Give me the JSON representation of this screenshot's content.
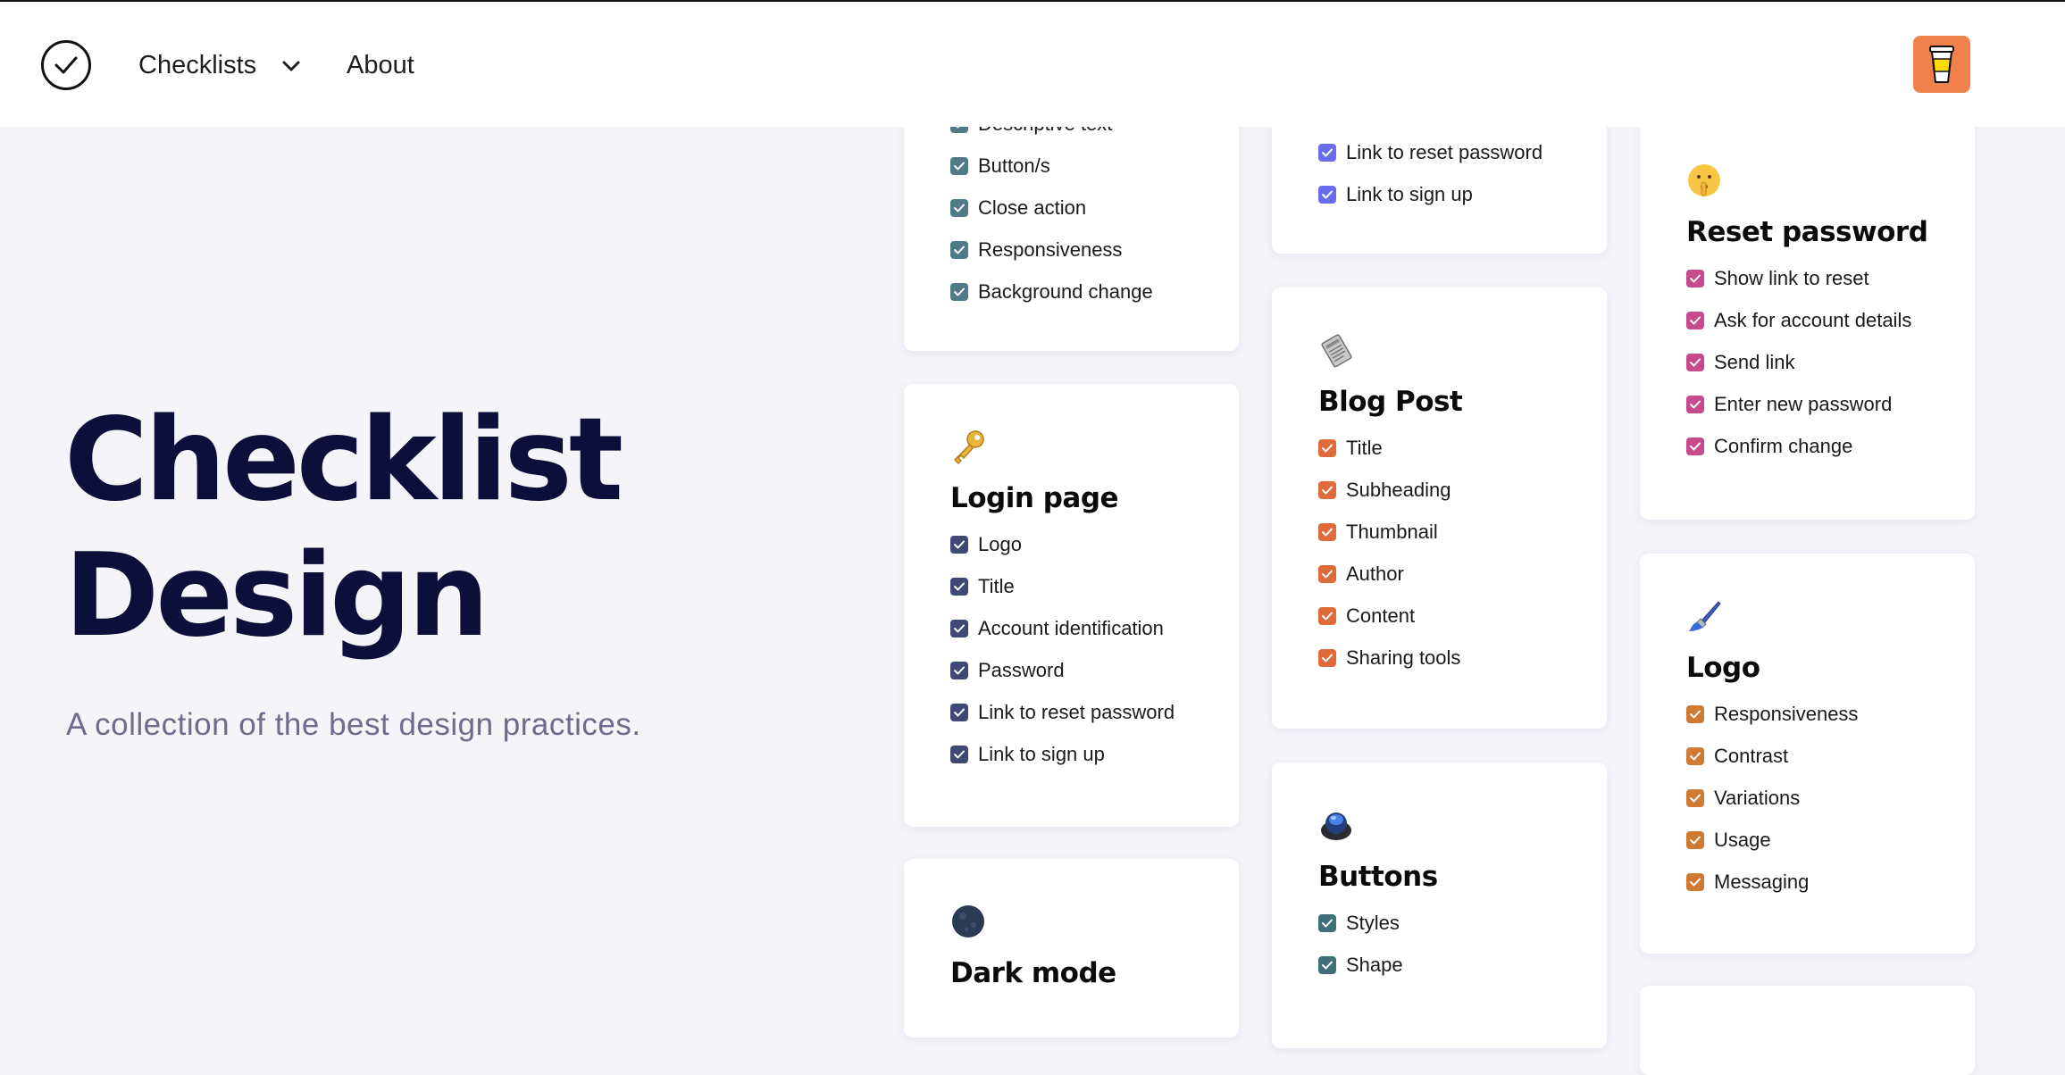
{
  "nav": {
    "checklists_label": "Checklists",
    "about_label": "About"
  },
  "hero": {
    "title_line1": "Checklist",
    "title_line2": "Design",
    "subtitle": "A collection of the best design practices."
  },
  "cards": {
    "modal": {
      "color": "#4f7a87",
      "items": [
        "Descriptive text",
        "Button/s",
        "Close action",
        "Responsiveness",
        "Background change"
      ]
    },
    "signup": {
      "color": "#6a6cf0",
      "items": [
        "Link to reset password",
        "Link to sign up"
      ]
    },
    "reset": {
      "icon": "shushing-face-icon",
      "title": "Reset password",
      "color": "#c64a8c",
      "items": [
        "Show link to reset",
        "Ask for account details",
        "Send link",
        "Enter new password",
        "Confirm change"
      ]
    },
    "login": {
      "icon": "key-icon",
      "title": "Login page",
      "color": "#3d4a75",
      "items": [
        "Logo",
        "Title",
        "Account identification",
        "Password",
        "Link to reset password",
        "Link to sign up"
      ]
    },
    "blog": {
      "icon": "newspaper-icon",
      "title": "Blog Post",
      "color": "#e06a3a",
      "items": [
        "Title",
        "Subheading",
        "Thumbnail",
        "Author",
        "Content",
        "Sharing tools"
      ]
    },
    "logo": {
      "icon": "paintbrush-icon",
      "title": "Logo",
      "color": "#d07a34",
      "items": [
        "Responsiveness",
        "Contrast",
        "Variations",
        "Usage",
        "Messaging"
      ]
    },
    "dark": {
      "icon": "new-moon-icon",
      "title": "Dark mode"
    },
    "buttons": {
      "icon": "button-icon",
      "title": "Buttons",
      "color": "#3f6f78",
      "items": [
        "Styles",
        "Shape"
      ]
    }
  }
}
